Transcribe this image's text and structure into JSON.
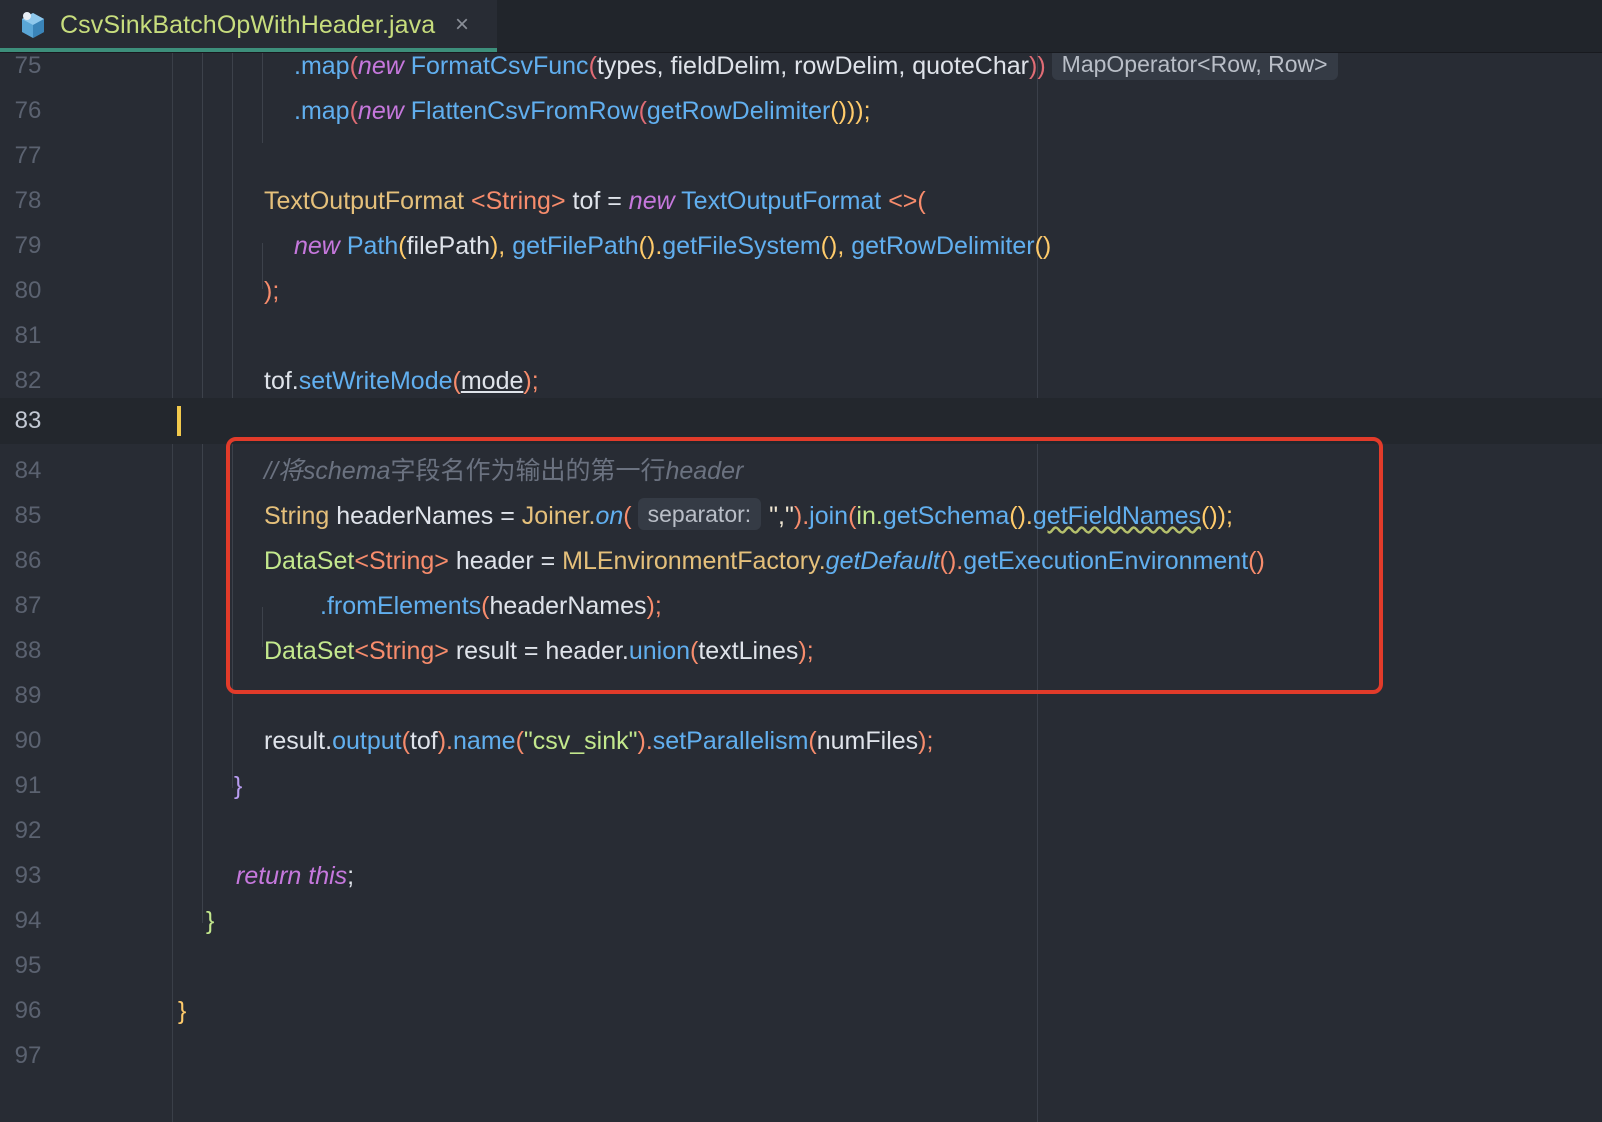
{
  "tab": {
    "title": "CsvSinkBatchOpWithHeader.java",
    "close_glyph": "×",
    "icon": "java-class-icon",
    "accent": "#3d8f7b"
  },
  "editor": {
    "current_line": 83,
    "lines": [
      {
        "n": "75"
      },
      {
        "n": "76"
      },
      {
        "n": "77"
      },
      {
        "n": "78"
      },
      {
        "n": "79"
      },
      {
        "n": "80"
      },
      {
        "n": "81"
      },
      {
        "n": "82"
      },
      {
        "n": "83"
      },
      {
        "n": "84"
      },
      {
        "n": "85"
      },
      {
        "n": "86"
      },
      {
        "n": "87"
      },
      {
        "n": "88"
      },
      {
        "n": "89"
      },
      {
        "n": "90"
      },
      {
        "n": "91"
      },
      {
        "n": "92"
      },
      {
        "n": "93"
      },
      {
        "n": "94"
      },
      {
        "n": "95"
      },
      {
        "n": "96"
      },
      {
        "n": "97"
      }
    ],
    "code": {
      "l75": {
        "a": ".map",
        "b": "(",
        "c": "new",
        "d": "FormatCsvFunc",
        "e": "(",
        "f": "types, fieldDelim, rowDelim, quoteChar",
        "g": "))",
        "hint": "MapOperator<Row, Row>"
      },
      "l76": {
        "a": ".map",
        "b": "(",
        "c": "new",
        "d": "FlattenCsvFromRow",
        "e": "(",
        "f": "getRowDelimiter",
        "g": "()));"
      },
      "l78": {
        "a": "TextOutputFormat",
        "b": "<String>",
        "c": "tof = ",
        "d": "new",
        "e": "TextOutputFormat",
        "f": "<>("
      },
      "l79": {
        "a": "new",
        "b": "Path",
        "c": "(",
        "d": "filePath",
        "e": "), ",
        "f": "getFilePath",
        "g": "().",
        "h": "getFileSystem",
        "i": "(), ",
        "j": "getRowDelimiter",
        "k": "()"
      },
      "l80": {
        "a": ");"
      },
      "l82": {
        "a": "tof.",
        "b": "setWriteMode",
        "c": "(",
        "d": "mode",
        "e": ");"
      },
      "l84": {
        "a": "//将",
        "b": "schema",
        "c": "字段名作为输出的第一行",
        "d": "header"
      },
      "l85": {
        "a": "String",
        "b": "headerNames = ",
        "c": "Joiner.",
        "d": "on",
        "e": "(",
        "hint": "separator:",
        "f": "\",\"",
        "g": ").",
        "h": "join",
        "i": "(",
        "j": "in.",
        "k": "getSchema",
        "l": "().",
        "m": "getFieldNames",
        "n": "());"
      },
      "l86": {
        "a": "DataSet",
        "b": "<String>",
        "c": "header = ",
        "d": "MLEnvironmentFactory.",
        "e": "getDefault",
        "f": "().",
        "g": "getExecutionEnvironment",
        "h": "()"
      },
      "l87": {
        "a": ".fromElements",
        "b": "(",
        "c": "headerNames",
        "d": ");"
      },
      "l88": {
        "a": "DataSet",
        "b": "<String>",
        "c": "result = header.",
        "d": "union",
        "e": "(",
        "f": "textLines",
        "g": ");"
      },
      "l90": {
        "a": "result.",
        "b": "output",
        "c": "(",
        "d": "tof",
        "e": ").",
        "f": "name",
        "g": "(",
        "h": "\"csv_sink\"",
        "i": ").",
        "j": "setParallelism",
        "k": "(",
        "l": "numFiles",
        "m": ");"
      },
      "l91": {
        "a": "}"
      },
      "l93": {
        "a": "return this",
        "b": ";"
      },
      "l94": {
        "a": "}"
      },
      "l96": {
        "a": "}"
      }
    }
  },
  "colors": {
    "background": "#282c34",
    "highlight_box": "#e23b2a",
    "caret": "#f2c94c"
  }
}
